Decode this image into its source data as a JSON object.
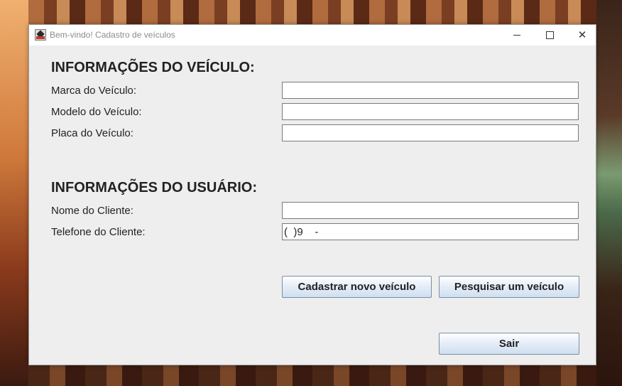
{
  "window": {
    "title": "Bem-vindo! Cadastro de veículos",
    "controls": {
      "minimize": "minimize-icon",
      "maximize": "maximize-icon",
      "close": "close-icon"
    }
  },
  "vehicle_section": {
    "heading": "INFORMAÇÕES DO VEÍCULO:",
    "brand_label": "Marca do Veículo:",
    "brand_value": "",
    "model_label": "Modelo do Veículo:",
    "model_value": "",
    "plate_label": "Placa do Veículo:",
    "plate_value": ""
  },
  "user_section": {
    "heading": "INFORMAÇÕES DO USUÁRIO:",
    "name_label": "Nome do Cliente:",
    "name_value": "",
    "phone_label": "Telefone do Cliente:",
    "phone_value": "(  )9    -"
  },
  "buttons": {
    "register": "Cadastrar novo veículo",
    "search": "Pesquisar um veículo",
    "exit": "Sair"
  },
  "colors": {
    "window_bg": "#eeeeee",
    "titlebar_bg": "#ffffff",
    "button_border": "#7a8ea8"
  }
}
